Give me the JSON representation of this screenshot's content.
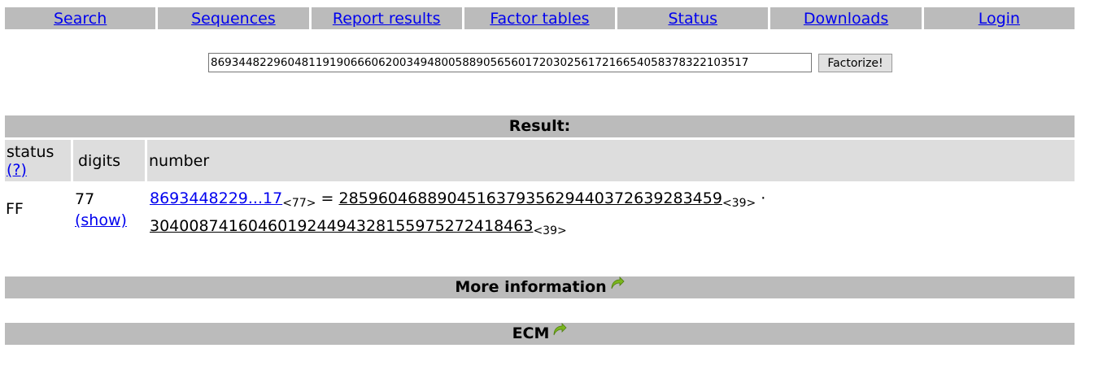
{
  "nav": {
    "items": [
      {
        "label": "Search"
      },
      {
        "label": "Sequences"
      },
      {
        "label": "Report results"
      },
      {
        "label": "Factor tables"
      },
      {
        "label": "Status"
      },
      {
        "label": "Downloads"
      },
      {
        "label": "Login"
      }
    ]
  },
  "form": {
    "input_value": "86934482296048119190666062003494800588905656017203025617216654058378322103517",
    "button_label": "Factorize!"
  },
  "result": {
    "header": "Result:",
    "columns": {
      "status": "status",
      "status_help": "(?)",
      "digits": "digits",
      "number": "number"
    },
    "row": {
      "status": "FF",
      "digits": "77",
      "show_link": "(show)",
      "number_link": "8693448229...17",
      "number_digits": "<77>",
      "equals": "=",
      "factor1": "285960468890451637935629440372639283459",
      "factor1_digits": "<39>",
      "dot": "·",
      "factor2": "304008741604601924494328155975272418463",
      "factor2_digits": "<39>"
    }
  },
  "sections": {
    "more_info": "More information",
    "ecm": "ECM"
  },
  "colors": {
    "bar_gray": "#bbbbbb",
    "header_gray": "#dddddd",
    "link_blue": "#0000ee",
    "arrow_green": "#7ab51d"
  }
}
